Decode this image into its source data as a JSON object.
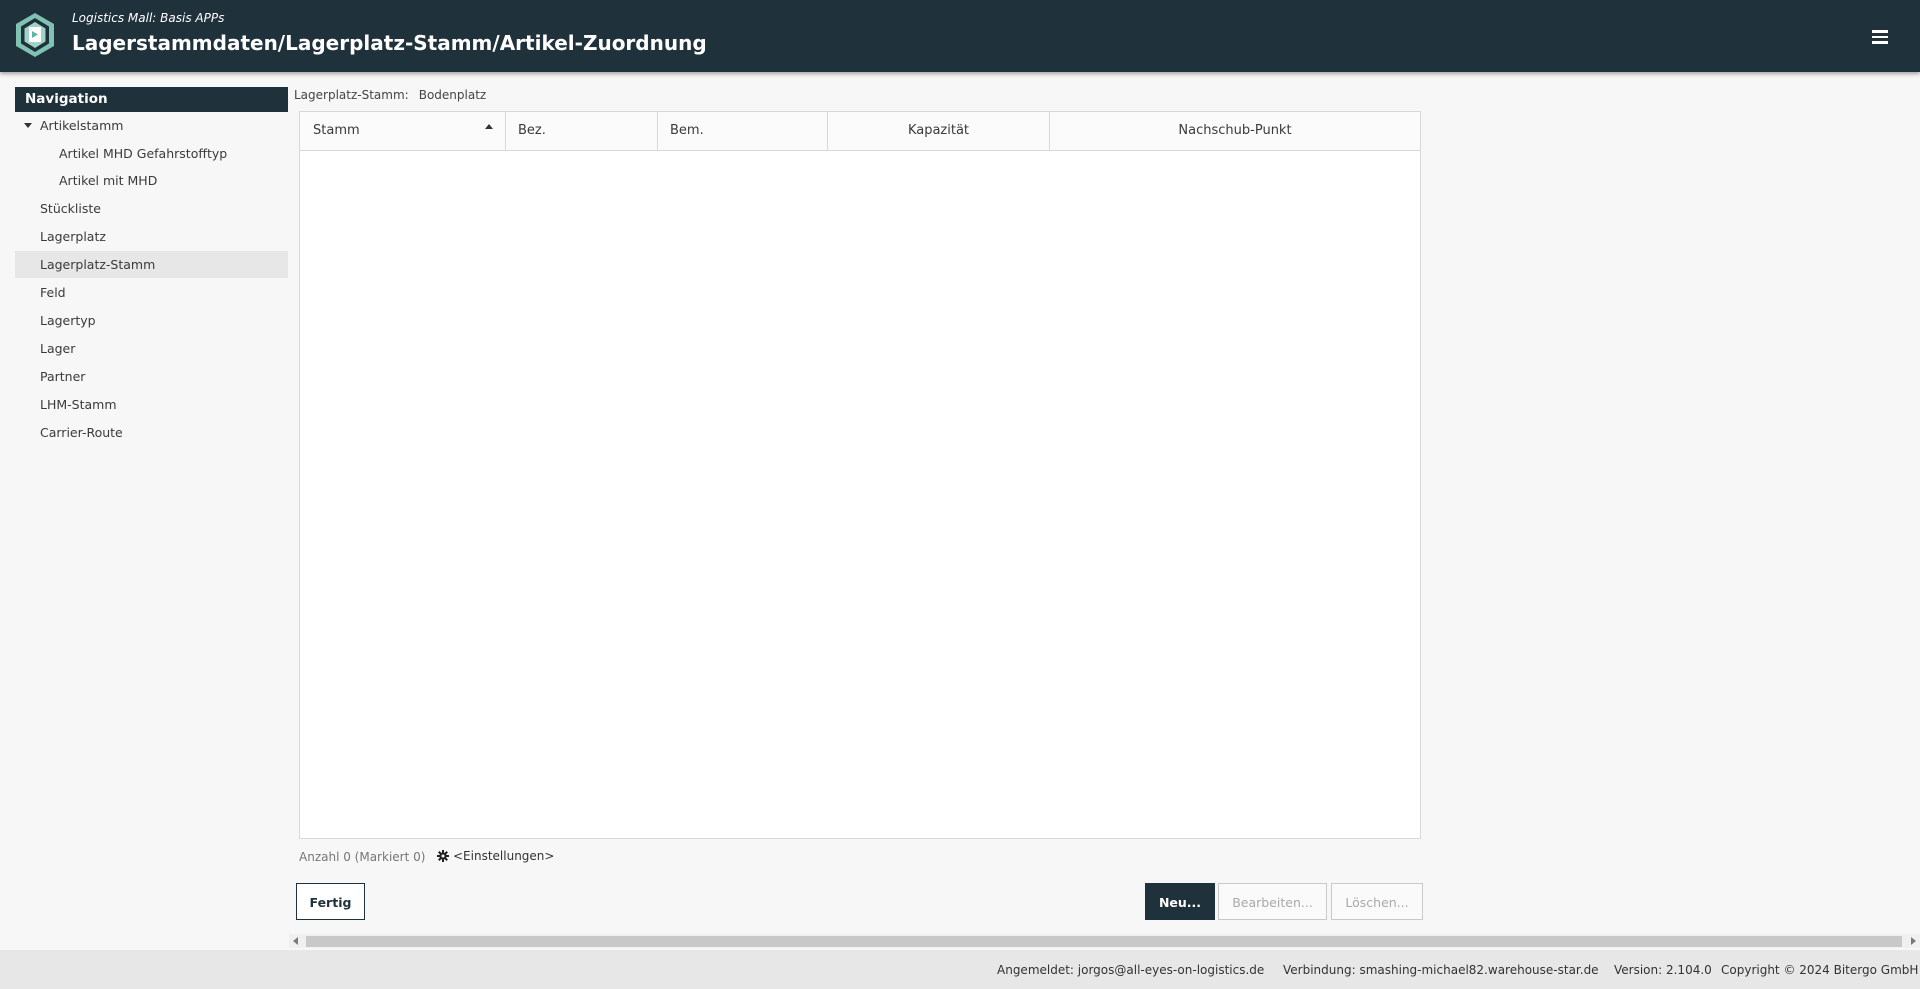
{
  "header": {
    "subtitle": "Logistics Mall: Basis APPs",
    "title": "Lagerstammdaten/Lagerplatz-Stamm/Artikel-Zuordnung",
    "menu_icon": "hamburger-icon",
    "logo_icon": "hexagon-logo-icon"
  },
  "sidebar": {
    "title": "Navigation",
    "items": [
      {
        "label": "Artikelstamm"
      },
      {
        "label": "Artikel MHD Gefahrstofftyp"
      },
      {
        "label": "Artikel mit MHD"
      },
      {
        "label": "Stückliste"
      },
      {
        "label": "Lagerplatz"
      },
      {
        "label": "Lagerplatz-Stamm"
      },
      {
        "label": "Feld"
      },
      {
        "label": "Lagertyp"
      },
      {
        "label": "Lager"
      },
      {
        "label": "Partner"
      },
      {
        "label": "LHM-Stamm"
      },
      {
        "label": "Carrier-Route"
      }
    ]
  },
  "breadcrumb": {
    "label": "Lagerplatz-Stamm:",
    "value": "Bodenplatz"
  },
  "table": {
    "columns": [
      {
        "label": "Stamm"
      },
      {
        "label": "Bez."
      },
      {
        "label": "Bem."
      },
      {
        "label": "Kapazität"
      },
      {
        "label": "Nachschub-Punkt"
      }
    ],
    "rows": []
  },
  "status": {
    "count_text": "Anzahl 0 (Markiert 0)",
    "settings_label": "<Einstellungen>"
  },
  "buttons": {
    "done": "Fertig",
    "new": "Neu...",
    "edit": "Bearbeiten...",
    "delete": "Löschen..."
  },
  "footer": {
    "user": "Angemeldet: jorgos@all-eyes-on-logistics.de",
    "connection": "Verbindung: smashing-michael82.warehouse-star.de",
    "version": "Version: 2.104.0",
    "copyright": "Copyright © 2024 Bitergo GmbH"
  },
  "colors": {
    "header_bg": "#1f313b",
    "active_item_bg": "#e7e7e7",
    "logo_accent": "#5fb5a0"
  }
}
